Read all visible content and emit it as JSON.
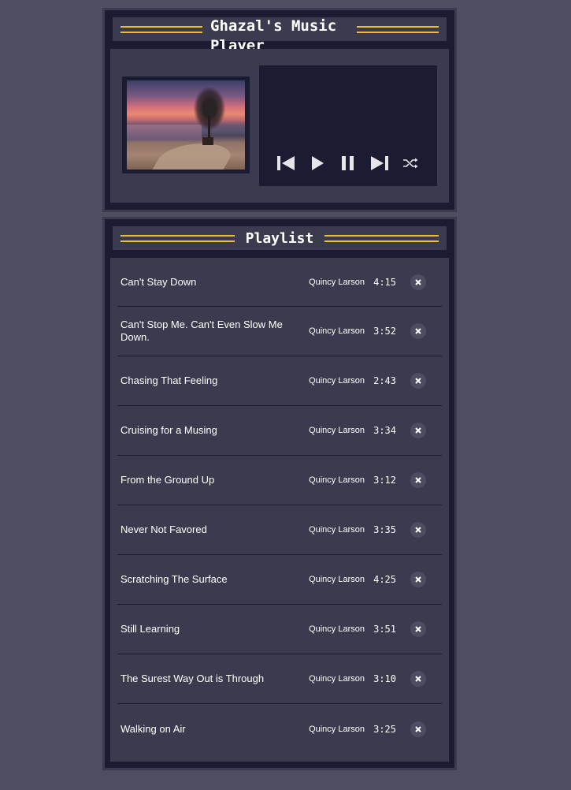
{
  "player": {
    "title": "Ghazal's Music Player",
    "album_art_alt": "",
    "controls": [
      "previous-icon",
      "play-icon",
      "pause-icon",
      "next-icon",
      "shuffle-icon"
    ]
  },
  "playlist": {
    "title": "Playlist",
    "songs": [
      {
        "title": "Can't Stay Down",
        "artist": "Quincy Larson",
        "duration": "4:15"
      },
      {
        "title": "Can't Stop Me. Can't Even Slow Me Down.",
        "artist": "Quincy Larson",
        "duration": "3:52"
      },
      {
        "title": "Chasing That Feeling",
        "artist": "Quincy Larson",
        "duration": "2:43"
      },
      {
        "title": "Cruising for a Musing",
        "artist": "Quincy Larson",
        "duration": "3:34"
      },
      {
        "title": "From the Ground Up",
        "artist": "Quincy Larson",
        "duration": "3:12"
      },
      {
        "title": "Never Not Favored",
        "artist": "Quincy Larson",
        "duration": "3:35"
      },
      {
        "title": "Scratching The Surface",
        "artist": "Quincy Larson",
        "duration": "4:25"
      },
      {
        "title": "Still Learning",
        "artist": "Quincy Larson",
        "duration": "3:51"
      },
      {
        "title": "The Surest Way Out is Through",
        "artist": "Quincy Larson",
        "duration": "3:10"
      },
      {
        "title": "Walking on Air",
        "artist": "Quincy Larson",
        "duration": "3:25"
      }
    ]
  },
  "colors": {
    "background": "#4e4e62",
    "panel": "#1b1b32",
    "panel_inner": "#3b3b4f",
    "accent": "#f1be32"
  }
}
